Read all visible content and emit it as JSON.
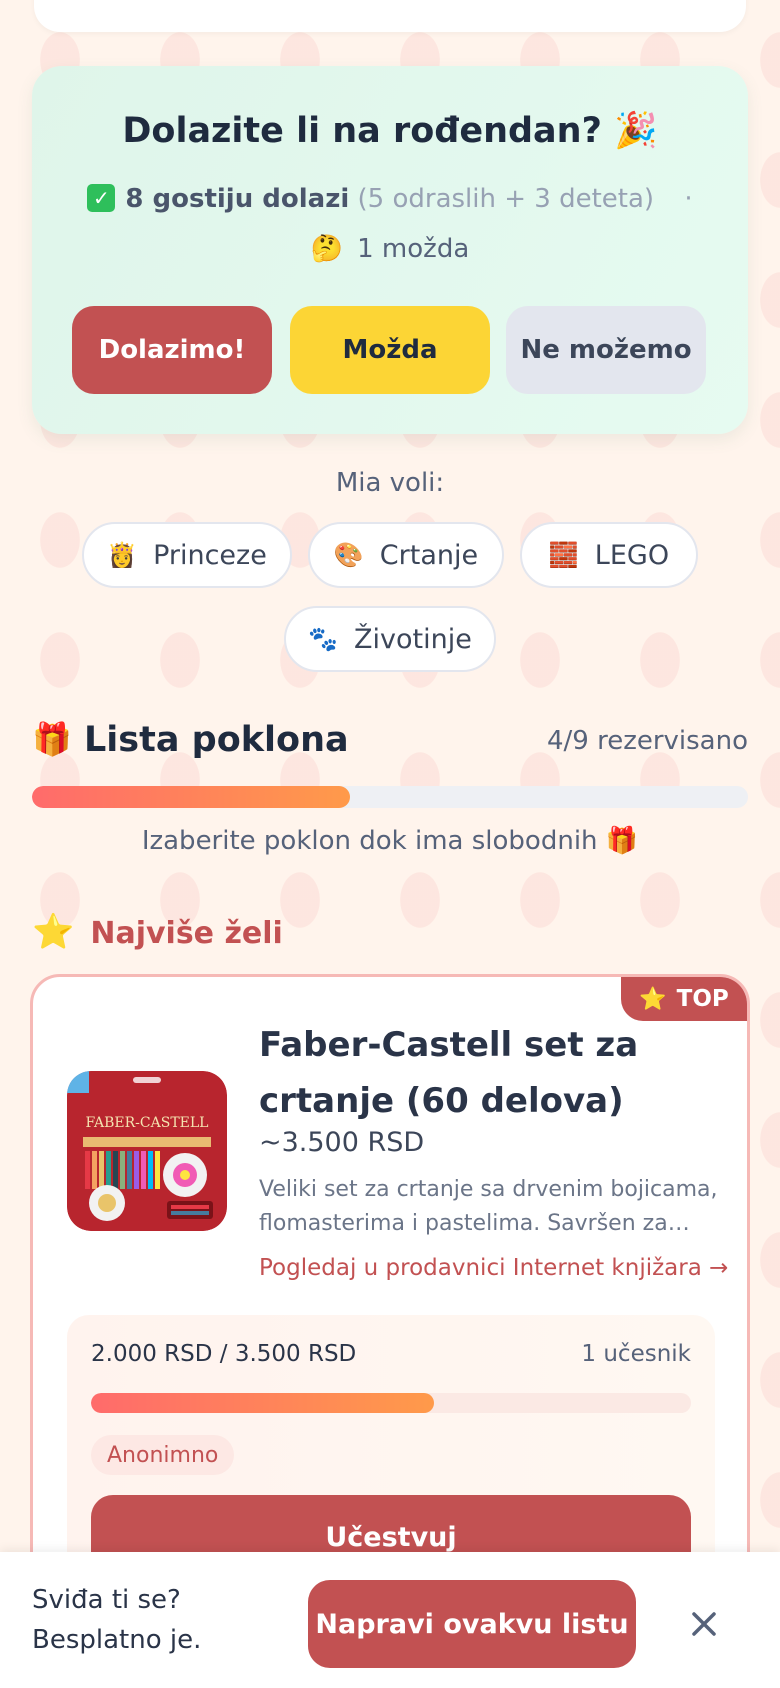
{
  "rsvp": {
    "title": "Dolazite li na rođendan? 🎉",
    "attending_icon": "✓",
    "attending": "8 gostiju dolazi",
    "attending_detail": "(5 odraslih + 3 deteta)",
    "separator": "·",
    "maybe_emoji": "🤔",
    "maybe": "1 možda",
    "btn_yes": "Dolazimo!",
    "btn_maybe": "Možda",
    "btn_no": "Ne možemo"
  },
  "likes": {
    "title": "Mia voli:",
    "chips": [
      {
        "icon": "👸",
        "label": "Princeze"
      },
      {
        "icon": "🎨",
        "label": "Crtanje"
      },
      {
        "icon": "🧱",
        "label": "LEGO"
      },
      {
        "icon": "🐾",
        "label": "Životinje"
      }
    ]
  },
  "gifts": {
    "icon": "🎁",
    "title": "Lista poklona",
    "count": "4/9 rezervisano",
    "reserved_fraction": 0.444,
    "hint": "Izaberite poklon dok ima slobodnih 🎁"
  },
  "section": {
    "icon": "⭐",
    "title": "Najviše želi"
  },
  "product": {
    "badge_icon": "⭐",
    "badge": "TOP",
    "image_brand": "FABER-CASTELL",
    "name": "Faber-Castell set za crtanje (60 delova)",
    "price": "~3.500 RSD",
    "description": "Veliki set za crtanje sa drvenim bojicama, flomasterima i pastelima. Savršen za male umetnike.",
    "link": "Pogledaj u prodavnici Internet knjižara →",
    "contribution": {
      "amount": "2.000 RSD / 3.500 RSD",
      "participants": "1 učesnik",
      "fraction": 0.571,
      "tag": "Anonimno",
      "button": "Učestvuj"
    }
  },
  "bottom": {
    "line1": "Sviđa ti se?",
    "line2": "Besplatno je.",
    "cta": "Napravi ovakvu listu",
    "close_icon": "close-icon"
  },
  "colors": {
    "accent": "#c25152",
    "yellow": "#fcd535",
    "mint": "#dff5ea",
    "background": "#fff4ec"
  }
}
